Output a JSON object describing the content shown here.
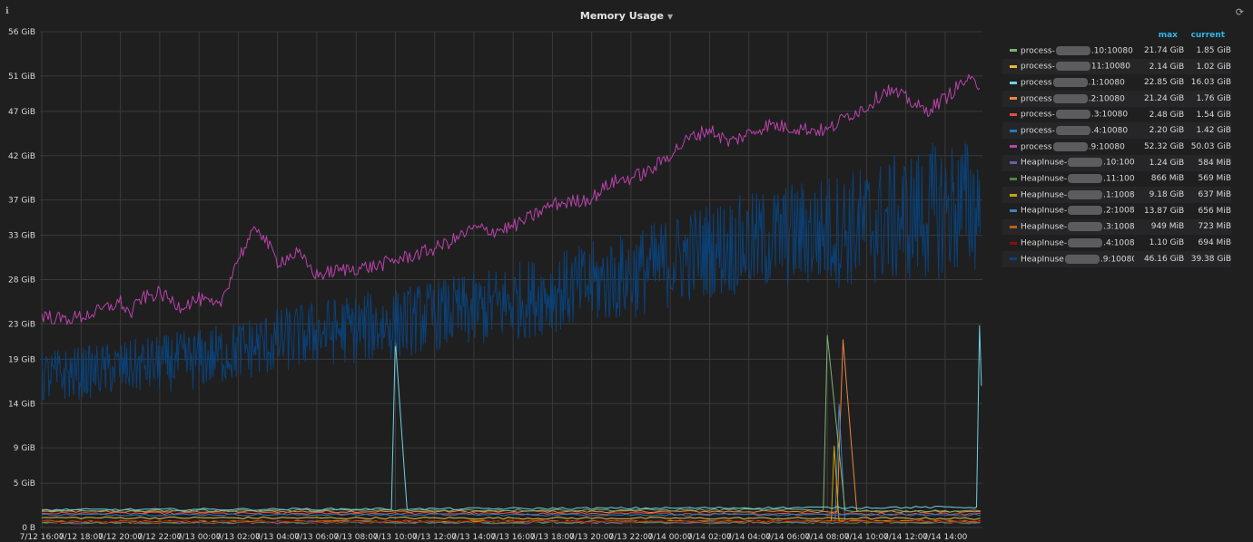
{
  "panel": {
    "title": "Memory Usage",
    "info_icon": "info-icon",
    "loading_icon": "spinner-icon"
  },
  "legend": {
    "col_max": "max",
    "col_current": "current",
    "rows": [
      {
        "prefix": "process-",
        "suffix": ".10:10080",
        "max": "21.74 GiB",
        "current": "1.85 GiB",
        "color": "#7eb26d"
      },
      {
        "prefix": "process-",
        "suffix": "11:10080",
        "max": "2.14 GiB",
        "current": "1.02 GiB",
        "color": "#eab839"
      },
      {
        "prefix": "process",
        "suffix": ".1:10080",
        "max": "22.85 GiB",
        "current": "16.03 GiB",
        "color": "#6ed0e0"
      },
      {
        "prefix": "process",
        "suffix": ".2:10080",
        "max": "21.24 GiB",
        "current": "1.76 GiB",
        "color": "#ef843c"
      },
      {
        "prefix": "process-",
        "suffix": ".3:10080",
        "max": "2.48 GiB",
        "current": "1.54 GiB",
        "color": "#e24d42"
      },
      {
        "prefix": "process-",
        "suffix": ".4:10080",
        "max": "2.20 GiB",
        "current": "1.42 GiB",
        "color": "#1f78c1"
      },
      {
        "prefix": "process",
        "suffix": ".9:10080",
        "max": "52.32 GiB",
        "current": "50.03 GiB",
        "color": "#ba43a9"
      },
      {
        "prefix": "HeapInuse-",
        "suffix": ".10:10080",
        "max": "1.24 GiB",
        "current": "584 MiB",
        "color": "#705da0"
      },
      {
        "prefix": "HeapInuse-",
        "suffix": ".11:10080",
        "max": "866 MiB",
        "current": "569 MiB",
        "color": "#508642"
      },
      {
        "prefix": "HeapInuse-",
        "suffix": ".1:10080",
        "max": "9.18 GiB",
        "current": "637 MiB",
        "color": "#cca300"
      },
      {
        "prefix": "HeapInuse-",
        "suffix": ".2:10080",
        "max": "13.87 GiB",
        "current": "656 MiB",
        "color": "#447ebc"
      },
      {
        "prefix": "HeapInuse-",
        "suffix": ".3:10080",
        "max": "949 MiB",
        "current": "723 MiB",
        "color": "#c15c17"
      },
      {
        "prefix": "HeapInuse-",
        "suffix": ".4:10080",
        "max": "1.10 GiB",
        "current": "694 MiB",
        "color": "#890f02"
      },
      {
        "prefix": "HeapInuse",
        "suffix": ".9:10080",
        "max": "46.16 GiB",
        "current": "39.38 GiB",
        "color": "#0a437c"
      }
    ]
  },
  "chart_data": {
    "type": "line",
    "title": "Memory Usage",
    "ylim": [
      0,
      56
    ],
    "y_unit": "GiB",
    "y_ticks": [
      0,
      5,
      9,
      14,
      19,
      23,
      28,
      33,
      37,
      42,
      47,
      51,
      56
    ],
    "y_tick_labels": [
      "0 B",
      "5 GiB",
      "9 GiB",
      "14 GiB",
      "19 GiB",
      "23 GiB",
      "28 GiB",
      "33 GiB",
      "37 GiB",
      "42 GiB",
      "47 GiB",
      "51 GiB",
      "56 GiB"
    ],
    "x_tick_labels": [
      "7/12 16:00",
      "7/12 18:00",
      "7/12 20:00",
      "7/12 22:00",
      "7/13 00:00",
      "7/13 02:00",
      "7/13 04:00",
      "7/13 06:00",
      "7/13 08:00",
      "7/13 10:00",
      "7/13 12:00",
      "7/13 14:00",
      "7/13 16:00",
      "7/13 18:00",
      "7/13 20:00",
      "7/13 22:00",
      "7/14 00:00",
      "7/14 02:00",
      "7/14 04:00",
      "7/14 06:00",
      "7/14 08:00",
      "7/14 10:00",
      "7/14 12:00",
      "7/14 14:00"
    ],
    "x_hours_range": [
      -0.1,
      47.9
    ],
    "grid": true,
    "legend_position": "right",
    "series": [
      {
        "name_ref": 6,
        "color": "#ba43a9",
        "x": [
          0,
          1,
          2,
          3,
          4,
          4.5,
          5,
          6,
          7,
          8,
          9,
          10,
          11,
          12,
          13,
          14,
          15,
          16,
          17,
          18,
          19,
          20,
          21,
          22,
          23,
          24,
          25,
          26,
          27,
          28,
          29,
          30,
          31,
          32,
          33,
          34,
          35,
          36,
          37,
          38,
          39,
          40,
          41,
          42,
          43,
          44,
          45,
          46,
          47,
          47.8
        ],
        "y": [
          24,
          23.5,
          23.8,
          24.5,
          25.5,
          24,
          25.8,
          26.5,
          25,
          25.8,
          24.8,
          30.5,
          34,
          30,
          31,
          28.5,
          29,
          29.3,
          29.5,
          30.2,
          30.8,
          31.5,
          32.5,
          33.8,
          33.5,
          34,
          35.2,
          36.5,
          36.8,
          37.2,
          39,
          39.5,
          40.3,
          42.2,
          44,
          45,
          43.5,
          44.5,
          45.5,
          45.2,
          45,
          44.8,
          46.5,
          47.5,
          49.5,
          48.5,
          47,
          48.5,
          50.5,
          50
        ]
      },
      {
        "name_ref": 13,
        "color": "#0a437c",
        "x": [
          0,
          2,
          4,
          6,
          8,
          10,
          12,
          14,
          16,
          18,
          20,
          22,
          24,
          26,
          28,
          30,
          32,
          34,
          36,
          38,
          40,
          42,
          44,
          46,
          47.8
        ],
        "y_center": [
          17,
          17.5,
          18,
          18.5,
          19,
          20,
          21,
          22,
          22.5,
          23,
          24,
          24.5,
          25.5,
          26.5,
          27.5,
          28.5,
          30,
          31.5,
          32,
          33,
          33.5,
          34,
          35,
          36,
          36.5
        ],
        "y_spread": [
          6,
          6,
          6,
          6.5,
          7,
          7,
          7.5,
          7.5,
          8,
          8,
          8,
          8.5,
          9,
          9,
          9.5,
          10,
          10.5,
          11,
          11.5,
          12,
          13,
          14,
          15,
          16,
          16
        ]
      },
      {
        "name_ref": 2,
        "color": "#6ed0e0",
        "x": [
          0,
          17.8,
          18.0,
          18.6,
          19.0,
          47.6,
          47.75,
          47.85
        ],
        "y": [
          2.0,
          2.1,
          21.2,
          2.0,
          2.1,
          2.3,
          22.8,
          16.0
        ]
      },
      {
        "name_ref": 0,
        "color": "#7eb26d",
        "x": [
          0,
          39.8,
          40.0,
          40.9,
          41.0,
          47.8
        ],
        "y": [
          1.9,
          2.0,
          21.7,
          2.0,
          1.9,
          1.85
        ]
      },
      {
        "name_ref": 3,
        "color": "#ef843c",
        "x": [
          0,
          40.5,
          40.8,
          41.5,
          41.7,
          47.8
        ],
        "y": [
          1.8,
          1.8,
          21.2,
          1.9,
          1.8,
          1.76
        ]
      },
      {
        "name_ref": 10,
        "color": "#447ebc",
        "x": [
          0,
          40.4,
          40.6,
          40.9,
          47.8
        ],
        "y": [
          0.6,
          0.7,
          13.9,
          0.7,
          0.66
        ]
      },
      {
        "name_ref": 9,
        "color": "#cca300",
        "x": [
          0,
          40.2,
          40.35,
          40.6,
          47.8
        ],
        "y": [
          0.6,
          0.7,
          9.2,
          0.7,
          0.64
        ]
      },
      {
        "name_ref": 4,
        "color": "#e24d42",
        "x": [
          0,
          47.8
        ],
        "y": [
          1.6,
          1.54
        ]
      },
      {
        "name_ref": 5,
        "color": "#1f78c1",
        "x": [
          0,
          47.8
        ],
        "y": [
          1.45,
          1.42
        ]
      },
      {
        "name_ref": 1,
        "color": "#eab839",
        "x": [
          0,
          47.8
        ],
        "y": [
          1.1,
          1.02
        ]
      },
      {
        "name_ref": 7,
        "color": "#705da0",
        "x": [
          0,
          47.8
        ],
        "y": [
          0.55,
          0.57
        ]
      },
      {
        "name_ref": 8,
        "color": "#508642",
        "x": [
          0,
          47.8
        ],
        "y": [
          0.55,
          0.56
        ]
      },
      {
        "name_ref": 11,
        "color": "#c15c17",
        "x": [
          0,
          47.8
        ],
        "y": [
          0.7,
          0.71
        ]
      },
      {
        "name_ref": 12,
        "color": "#890f02",
        "x": [
          0,
          47.8
        ],
        "y": [
          0.65,
          0.68
        ]
      }
    ]
  }
}
